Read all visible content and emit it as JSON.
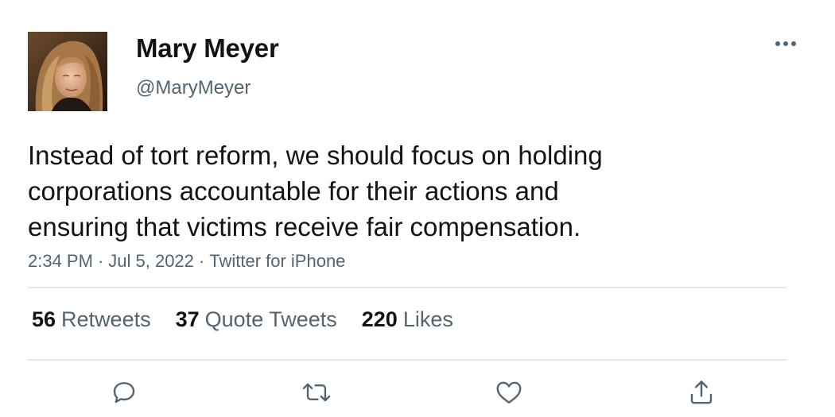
{
  "author": {
    "display_name": "Mary Meyer",
    "handle": "@MaryMeyer",
    "avatar": "profile-photo"
  },
  "tweet": {
    "text_lines": [
      "Instead of tort reform, we should focus on holding",
      "corporations accountable for their actions and",
      "ensuring that victims receive fair compensation."
    ],
    "time": "2:34 PM",
    "date": "Jul 5, 2022",
    "source": "Twitter for iPhone",
    "separator": "·"
  },
  "stats": {
    "retweets": {
      "count": "56",
      "label": "Retweets"
    },
    "quote_tweets": {
      "count": "37",
      "label": "Quote Tweets"
    },
    "likes": {
      "count": "220",
      "label": "Likes"
    }
  },
  "actions": {
    "reply": "reply-icon",
    "retweet": "retweet-icon",
    "like": "heart-icon",
    "share": "share-icon",
    "more": "more-icon"
  },
  "colors": {
    "text_primary": "#0f1419",
    "text_secondary": "#536471",
    "divider": "#e6e9ec",
    "background": "#ffffff"
  }
}
